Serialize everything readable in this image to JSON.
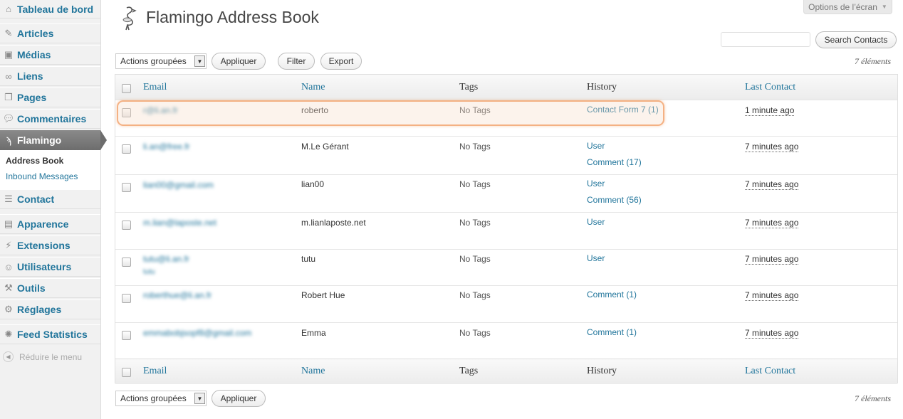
{
  "sidebar": {
    "dashboard": "Tableau de bord",
    "items": [
      {
        "label": "Articles",
        "icon": "pin-icon"
      },
      {
        "label": "Médias",
        "icon": "media-icon"
      },
      {
        "label": "Liens",
        "icon": "link-icon"
      },
      {
        "label": "Pages",
        "icon": "pages-icon"
      },
      {
        "label": "Commentaires",
        "icon": "comment-icon"
      },
      {
        "label": "Flamingo",
        "icon": "flamingo-icon"
      }
    ],
    "submenu": [
      "Address Book",
      "Inbound Messages"
    ],
    "contact": "Contact",
    "items2": [
      {
        "label": "Apparence",
        "icon": "appearance-icon"
      },
      {
        "label": "Extensions",
        "icon": "plugin-icon"
      },
      {
        "label": "Utilisateurs",
        "icon": "users-icon"
      },
      {
        "label": "Outils",
        "icon": "tools-icon"
      },
      {
        "label": "Réglages",
        "icon": "settings-icon"
      }
    ],
    "feed": "Feed Statistics",
    "collapse": "Réduire le menu"
  },
  "header": {
    "screen_options": "Options de l’écran",
    "title": "Flamingo Address Book",
    "search_button": "Search Contacts",
    "search_value": ""
  },
  "toolbar": {
    "bulk_actions": "Actions groupées",
    "apply": "Appliquer",
    "filter": "Filter",
    "export": "Export",
    "count": "7 éléments"
  },
  "table": {
    "columns": [
      "Email",
      "Name",
      "Tags",
      "History",
      "Last Contact"
    ],
    "rows": [
      {
        "email": "r@li.an.fr",
        "name": "roberto",
        "tags": "No Tags",
        "history": [
          "Contact Form 7 (1)"
        ],
        "last": "1 minute ago"
      },
      {
        "email": "li.an@free.fr",
        "name": "M.Le Gérant",
        "tags": "No Tags",
        "history": [
          "User",
          "Comment (17)"
        ],
        "last": "7 minutes ago"
      },
      {
        "email": "lian00@gmail.com",
        "name": "lian00",
        "tags": "No Tags",
        "history": [
          "User",
          "Comment (56)"
        ],
        "last": "7 minutes ago"
      },
      {
        "email": "m.lian@laposte.net",
        "name": "m.lianlaposte.net",
        "tags": "No Tags",
        "history": [
          "User"
        ],
        "last": "7 minutes ago"
      },
      {
        "email": "tutu@li.an.fr",
        "email_sub": "tutu",
        "name": "tutu",
        "tags": "No Tags",
        "history": [
          "User"
        ],
        "last": "7 minutes ago"
      },
      {
        "email": "roberthue@li.an.fr",
        "name": "Robert Hue",
        "tags": "No Tags",
        "history": [
          "Comment (1)"
        ],
        "last": "7 minutes ago"
      },
      {
        "email": "emmabobjsopf8@gmail.com",
        "name": "Emma",
        "tags": "No Tags",
        "history": [
          "Comment (1)"
        ],
        "last": "7 minutes ago"
      }
    ]
  },
  "colors": {
    "link": "#21759b",
    "active_menu": "#6d6d6d",
    "highlight": "#f4b183"
  }
}
